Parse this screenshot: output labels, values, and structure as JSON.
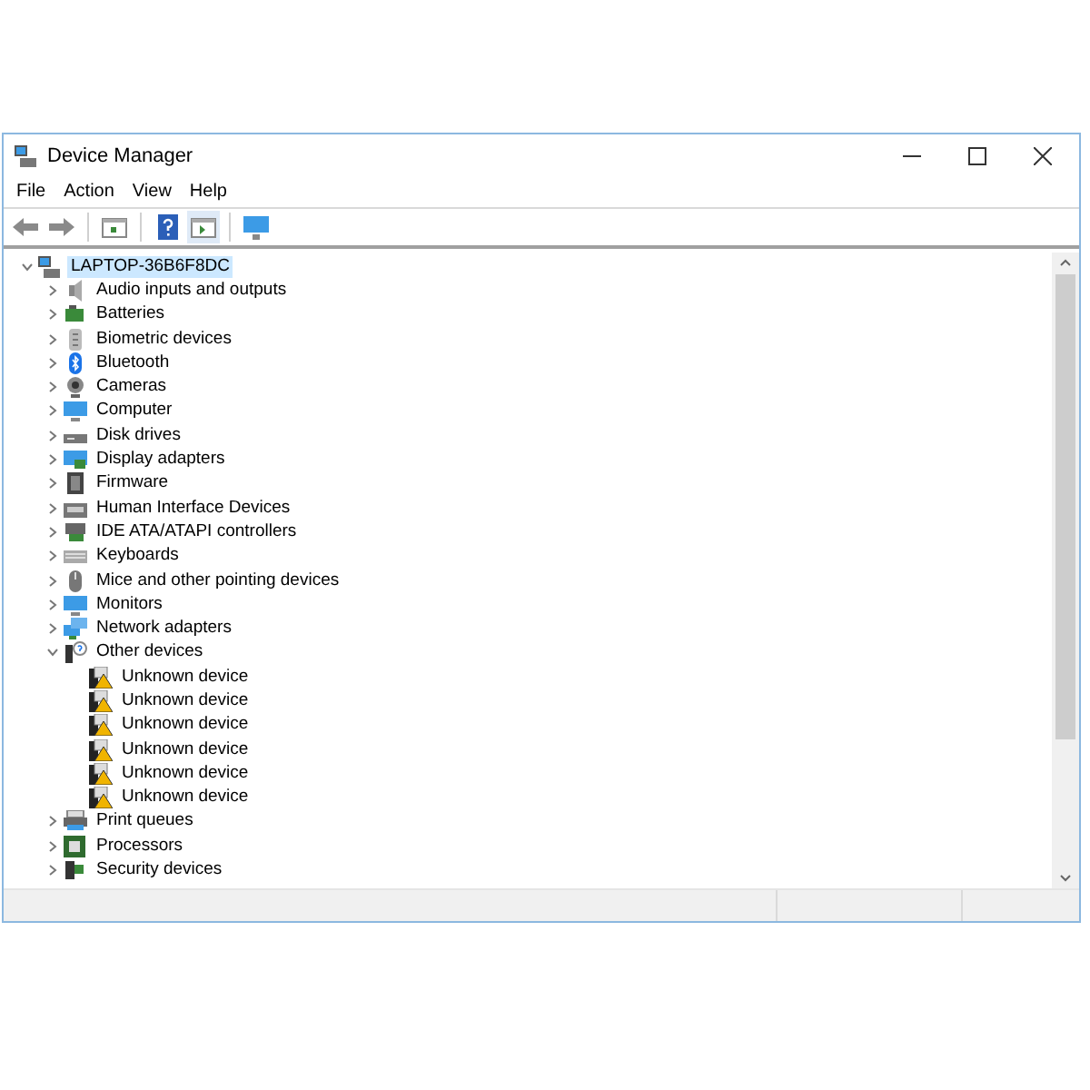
{
  "window": {
    "title": "Device Manager"
  },
  "menu": [
    "File",
    "Action",
    "View",
    "Help"
  ],
  "tree": {
    "label": "LAPTOP-36B6F8DC",
    "selected": true,
    "expanded": true,
    "children": [
      {
        "label": "Audio inputs and outputs",
        "expanded": false
      },
      {
        "label": "Batteries",
        "expanded": false
      },
      {
        "label": "Biometric devices",
        "expanded": false
      },
      {
        "label": "Bluetooth",
        "expanded": false
      },
      {
        "label": "Cameras",
        "expanded": false
      },
      {
        "label": "Computer",
        "expanded": false
      },
      {
        "label": "Disk drives",
        "expanded": false
      },
      {
        "label": "Display adapters",
        "expanded": false
      },
      {
        "label": "Firmware",
        "expanded": false
      },
      {
        "label": "Human Interface Devices",
        "expanded": false
      },
      {
        "label": "IDE ATA/ATAPI controllers",
        "expanded": false
      },
      {
        "label": "Keyboards",
        "expanded": false
      },
      {
        "label": "Mice and other pointing devices",
        "expanded": false
      },
      {
        "label": "Monitors",
        "expanded": false
      },
      {
        "label": "Network adapters",
        "expanded": false
      },
      {
        "label": "Other devices",
        "expanded": true,
        "children": [
          {
            "label": "Unknown device"
          },
          {
            "label": "Unknown device"
          },
          {
            "label": "Unknown device"
          },
          {
            "label": "Unknown device"
          },
          {
            "label": "Unknown device"
          },
          {
            "label": "Unknown device"
          }
        ]
      },
      {
        "label": "Print queues",
        "expanded": false
      },
      {
        "label": "Processors",
        "expanded": false
      },
      {
        "label": "Security devices",
        "expanded": false
      }
    ]
  }
}
